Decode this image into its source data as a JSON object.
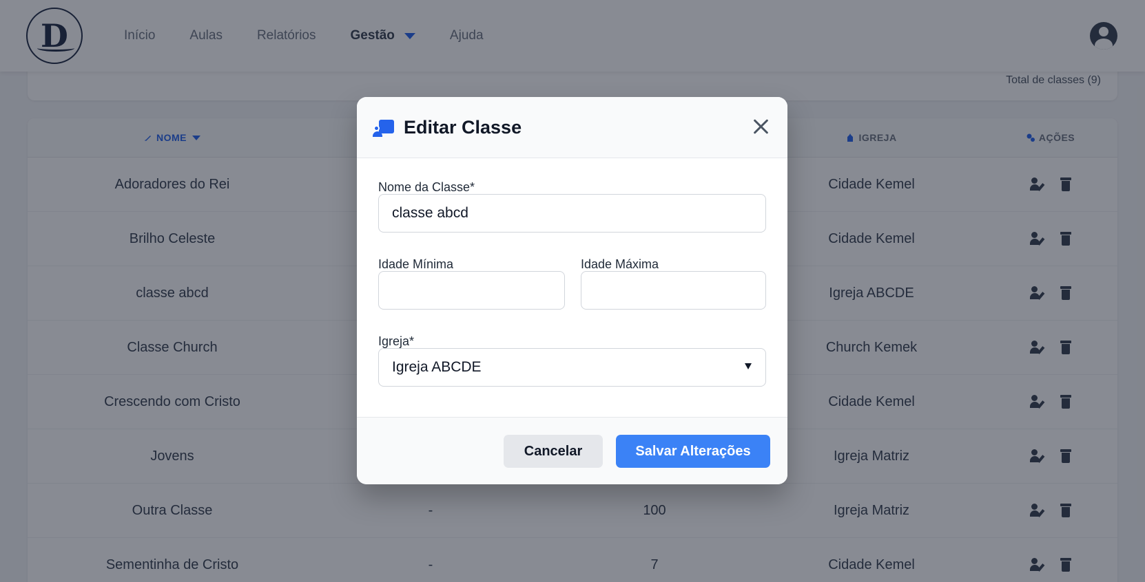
{
  "header": {
    "logo_text": "D",
    "nav": [
      {
        "label": "Início"
      },
      {
        "label": "Aulas"
      },
      {
        "label": "Relatórios"
      },
      {
        "label": "Gestão",
        "active": true
      },
      {
        "label": "Ajuda"
      }
    ]
  },
  "summary": {
    "total_label": "Total de classes (9)"
  },
  "table": {
    "columns": [
      "NOME",
      "",
      "",
      "IGREJA",
      "AÇÕES"
    ],
    "rows": [
      {
        "nome": "Adoradores do Rei",
        "c2": "",
        "c3": "",
        "igreja": "Cidade Kemel"
      },
      {
        "nome": "Brilho Celeste",
        "c2": "",
        "c3": "",
        "igreja": "Cidade Kemel"
      },
      {
        "nome": "classe abcd",
        "c2": "",
        "c3": "",
        "igreja": "Igreja ABCDE"
      },
      {
        "nome": "Classe Church",
        "c2": "",
        "c3": "",
        "igreja": "Church Kemek"
      },
      {
        "nome": "Crescendo com Cristo",
        "c2": "",
        "c3": "",
        "igreja": "Cidade Kemel"
      },
      {
        "nome": "Jovens",
        "c2": "",
        "c3": "",
        "igreja": "Igreja Matriz"
      },
      {
        "nome": "Outra Classe",
        "c2": "-",
        "c3": "100",
        "igreja": "Igreja Matriz"
      },
      {
        "nome": "Sementinha de Cristo",
        "c2": "-",
        "c3": "7",
        "igreja": "Cidade Kemel"
      }
    ]
  },
  "modal": {
    "title": "Editar Classe",
    "fields": {
      "nome_label": "Nome da Classe*",
      "nome_value": "classe abcd",
      "idade_min_label": "Idade Mínima",
      "idade_min_value": "",
      "idade_max_label": "Idade Máxima",
      "idade_max_value": "",
      "igreja_label": "Igreja*",
      "igreja_value": "Igreja ABCDE"
    },
    "cancel_label": "Cancelar",
    "save_label": "Salvar Alterações"
  },
  "colors": {
    "accent": "#3b82f6",
    "overlay": "rgba(17,24,39,0.5)"
  }
}
